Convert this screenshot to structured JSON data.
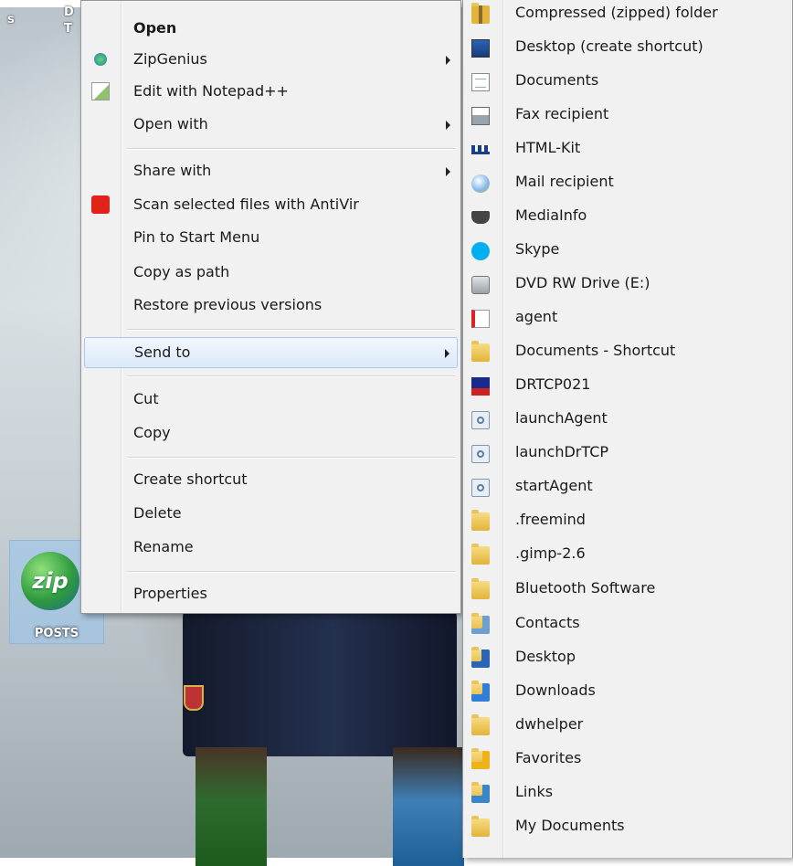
{
  "desktop": {
    "icon_label": "POSTS",
    "icon_text": "zip",
    "fragment_1": "s",
    "fragment_2": "D",
    "fragment_3": "T"
  },
  "context_menu": {
    "items": [
      {
        "label": "Open",
        "icon": "none",
        "bold": true
      },
      {
        "label": "ZipGenius",
        "icon": "zipgenius-icon",
        "submenu": true
      },
      {
        "label": "Edit with Notepad++",
        "icon": "notepad-icon"
      },
      {
        "label": "Open with",
        "icon": "none",
        "submenu": true
      },
      {
        "label": "Share with",
        "icon": "none",
        "submenu": true
      },
      {
        "label": "Scan selected files with AntiVir",
        "icon": "antivir-icon"
      },
      {
        "label": "Pin to Start Menu",
        "icon": "none"
      },
      {
        "label": "Copy as path",
        "icon": "none"
      },
      {
        "label": "Restore previous versions",
        "icon": "none"
      },
      {
        "label": "Send to",
        "icon": "none",
        "submenu": true,
        "highlighted": true
      },
      {
        "label": "Cut",
        "icon": "none"
      },
      {
        "label": "Copy",
        "icon": "none"
      },
      {
        "label": "Create shortcut",
        "icon": "none"
      },
      {
        "label": "Delete",
        "icon": "none"
      },
      {
        "label": "Rename",
        "icon": "none"
      },
      {
        "label": "Properties",
        "icon": "none"
      }
    ]
  },
  "send_to_menu": {
    "items": [
      {
        "label": "Compressed (zipped) folder",
        "icon": "zip-folder-icon"
      },
      {
        "label": "Desktop (create shortcut)",
        "icon": "desktop-icon"
      },
      {
        "label": "Documents",
        "icon": "document-icon"
      },
      {
        "label": "Fax recipient",
        "icon": "fax-icon"
      },
      {
        "label": "HTML-Kit",
        "icon": "html-kit-icon"
      },
      {
        "label": "Mail recipient",
        "icon": "mail-icon"
      },
      {
        "label": "MediaInfo",
        "icon": "mediainfo-icon"
      },
      {
        "label": "Skype",
        "icon": "skype-icon"
      },
      {
        "label": "DVD RW Drive (E:)",
        "icon": "dvd-drive-icon"
      },
      {
        "label": "agent",
        "icon": "agent-icon"
      },
      {
        "label": "Documents - Shortcut",
        "icon": "folder-doc-icon"
      },
      {
        "label": "DRTCP021",
        "icon": "drtcp-icon"
      },
      {
        "label": "launchAgent",
        "icon": "script-gear-icon"
      },
      {
        "label": "launchDrTCP",
        "icon": "script-gear-icon"
      },
      {
        "label": "startAgent",
        "icon": "script-gear-icon"
      },
      {
        "label": ".freemind",
        "icon": "folder-icon"
      },
      {
        "label": ".gimp-2.6",
        "icon": "folder-icon"
      },
      {
        "label": "Bluetooth Software",
        "icon": "folder-icon"
      },
      {
        "label": "Contacts",
        "icon": "contacts-folder-icon"
      },
      {
        "label": "Desktop",
        "icon": "desktop-folder-icon"
      },
      {
        "label": "Downloads",
        "icon": "downloads-folder-icon"
      },
      {
        "label": "dwhelper",
        "icon": "folder-icon"
      },
      {
        "label": "Favorites",
        "icon": "favorites-folder-icon"
      },
      {
        "label": "Links",
        "icon": "links-folder-icon"
      },
      {
        "label": "My Documents",
        "icon": "folder-doc-icon"
      }
    ]
  },
  "colors": {
    "menu_bg": "#f1f1f1",
    "highlight_border": "#a9c9ee",
    "antivir_red": "#e2231a",
    "skype_blue": "#00aff0"
  }
}
